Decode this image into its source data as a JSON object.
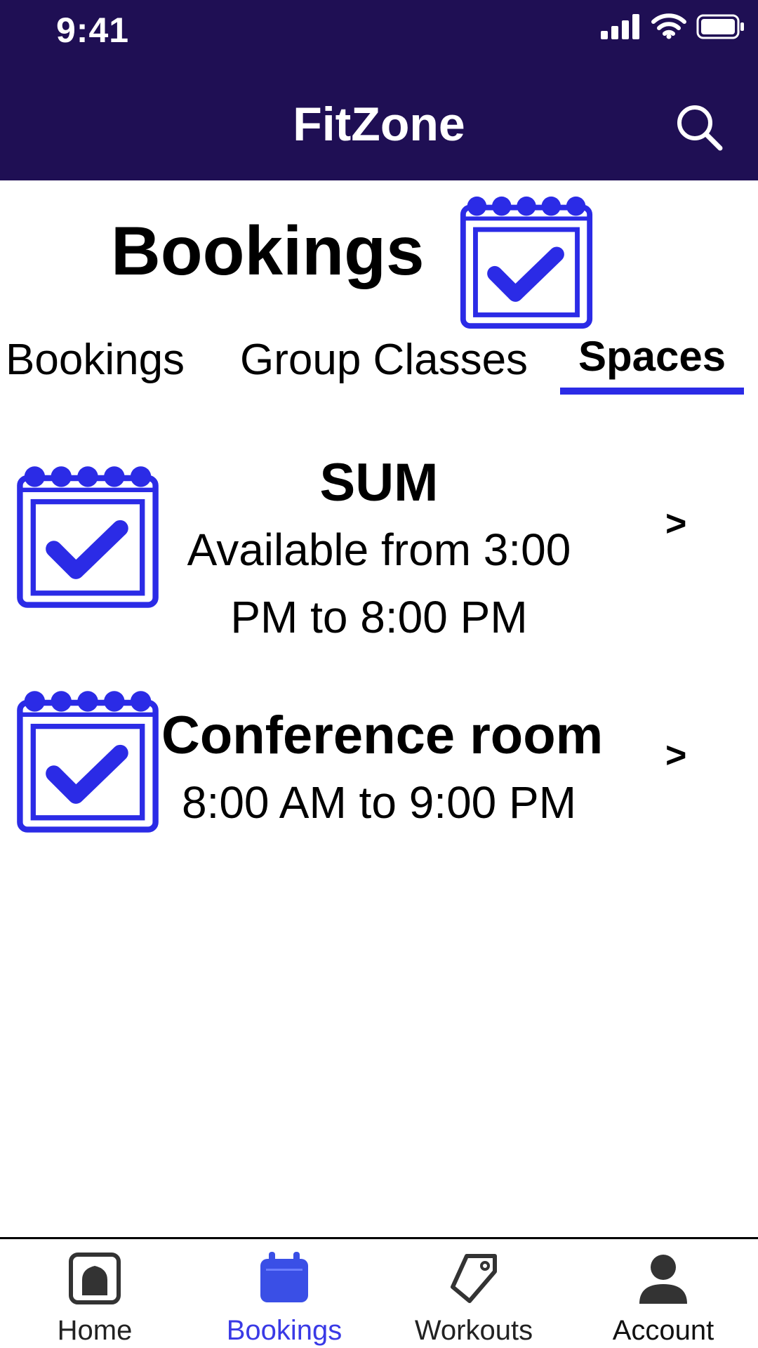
{
  "status_bar": {
    "time": "9:41"
  },
  "app_bar": {
    "title": "FitZone",
    "search_icon": "search-icon"
  },
  "page": {
    "title": "Bookings",
    "heading_icon": "calendar-check-icon"
  },
  "tabs": [
    {
      "label": "Bookings",
      "selected": false
    },
    {
      "label": "Group Classes",
      "selected": false
    },
    {
      "label": "Spaces",
      "selected": true
    }
  ],
  "spaces": [
    {
      "name": "SUM",
      "availability": "Available from 3:00 PM to 8:00 PM",
      "icon": "calendar-check-icon",
      "chevron": ">"
    },
    {
      "name": "Conference room",
      "availability": "8:00 AM to 9:00 PM",
      "icon": "calendar-check-icon",
      "chevron": ">"
    }
  ],
  "bottom_nav": [
    {
      "label": "Home",
      "icon": "home-icon",
      "active": false
    },
    {
      "label": "Bookings",
      "icon": "calendar-icon",
      "active": true
    },
    {
      "label": "Workouts",
      "icon": "tag-icon",
      "active": false
    },
    {
      "label": "Account",
      "icon": "person-icon",
      "active": false
    }
  ],
  "colors": {
    "app_bar_bg": "#1f0f54",
    "accent": "#2b2be6",
    "nav_active": "#3a3ae6"
  }
}
